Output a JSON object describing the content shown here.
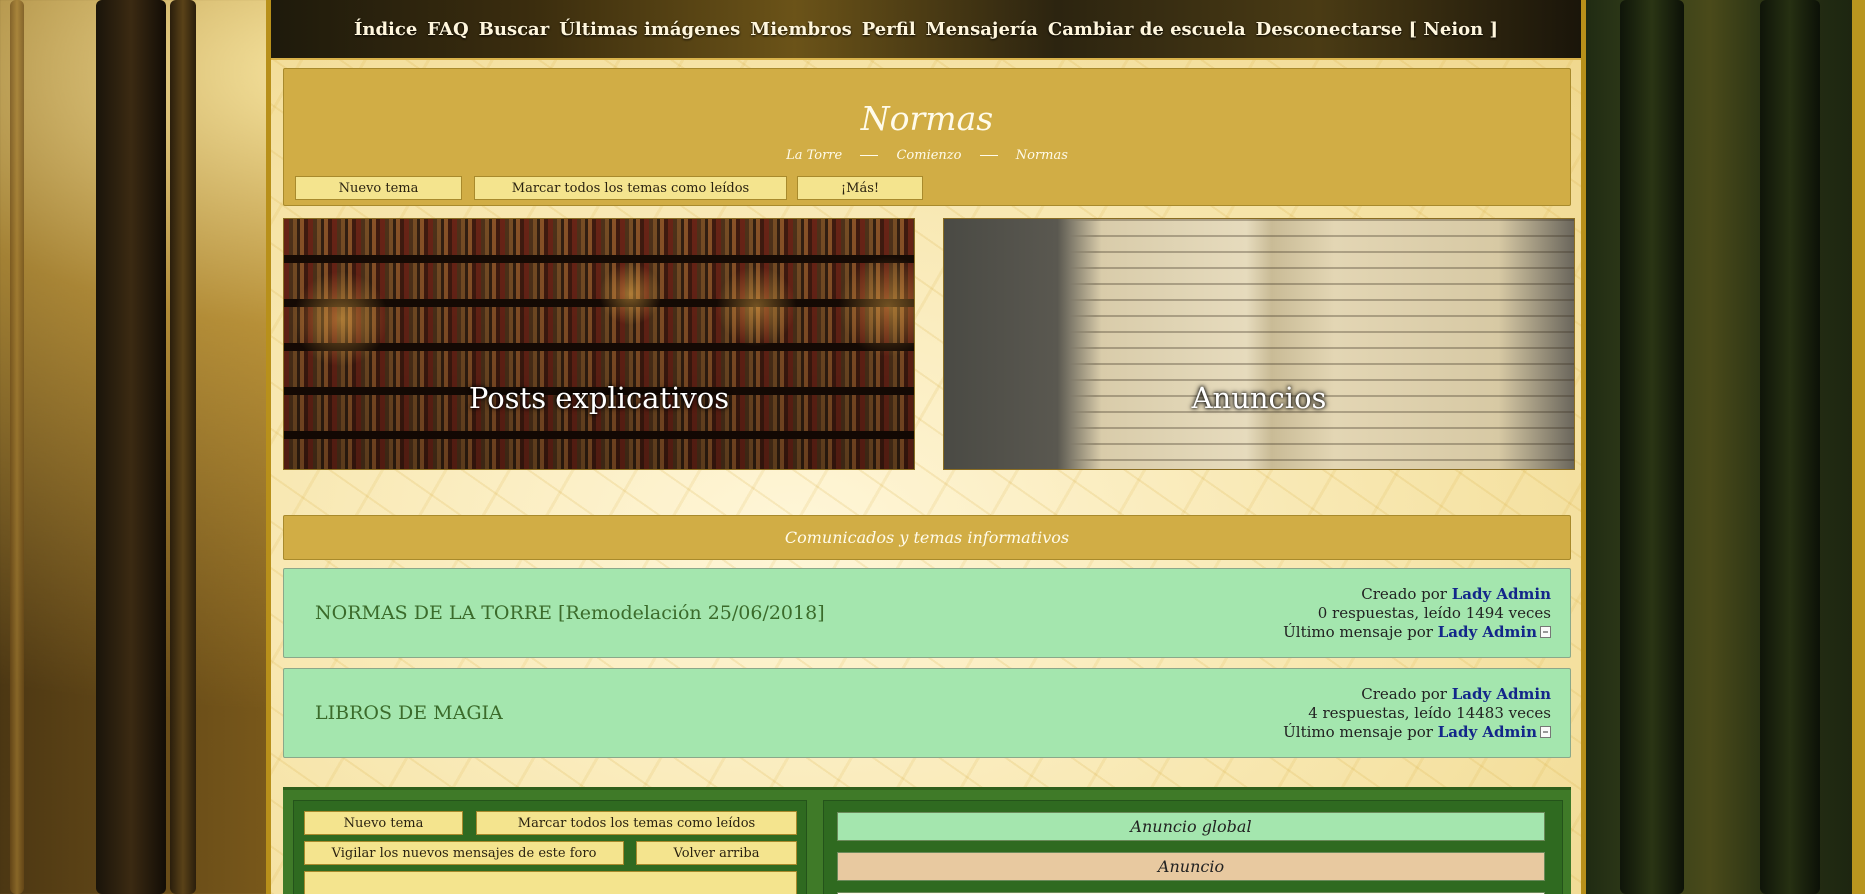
{
  "nav": {
    "items": [
      "Índice",
      "FAQ",
      "Buscar",
      "Últimas imágenes",
      "Miembros",
      "Perfil",
      "Mensajería",
      "Cambiar de escuela",
      "Desconectarse [ Neion ]"
    ]
  },
  "header": {
    "title": "Normas",
    "breadcrumb": [
      "La Torre",
      "Comienzo",
      "Normas"
    ],
    "buttons": {
      "new_topic": "Nuevo tema",
      "mark_read": "Marcar todos los temas como leídos",
      "more": "¡Más!"
    }
  },
  "tiles": [
    {
      "label": "Posts explicativos"
    },
    {
      "label": "Anuncios"
    }
  ],
  "category": {
    "title": "Comunicados y temas informativos"
  },
  "topics": [
    {
      "title": "NORMAS DE LA TORRE [Remodelación 25/06/2018]",
      "created_prefix": "Creado por",
      "author": "Lady Admin",
      "stats": "0 respuestas, leído 1494 veces",
      "last_prefix": "Último mensaje por",
      "last_user": "Lady Admin"
    },
    {
      "title": "LIBROS DE MAGIA",
      "created_prefix": "Creado por",
      "author": "Lady Admin",
      "stats": "4 respuestas, leído 14483 veces",
      "last_prefix": "Último mensaje por",
      "last_user": "Lady Admin"
    }
  ],
  "bottom": {
    "buttons": {
      "new_topic": "Nuevo tema",
      "mark_read": "Marcar todos los temas como leídos",
      "watch": "Vigilar los nuevos mensajes de este foro",
      "back_top": "Volver arriba"
    },
    "legend": {
      "global": "Anuncio global",
      "announcement": "Anuncio",
      "third": "..."
    }
  },
  "colors": {
    "gold": "#d1ad45",
    "button": "#f4e48e",
    "topic_green": "#a4e6ae",
    "link_blue": "#13268a",
    "panel_green": "#3f7a28"
  }
}
